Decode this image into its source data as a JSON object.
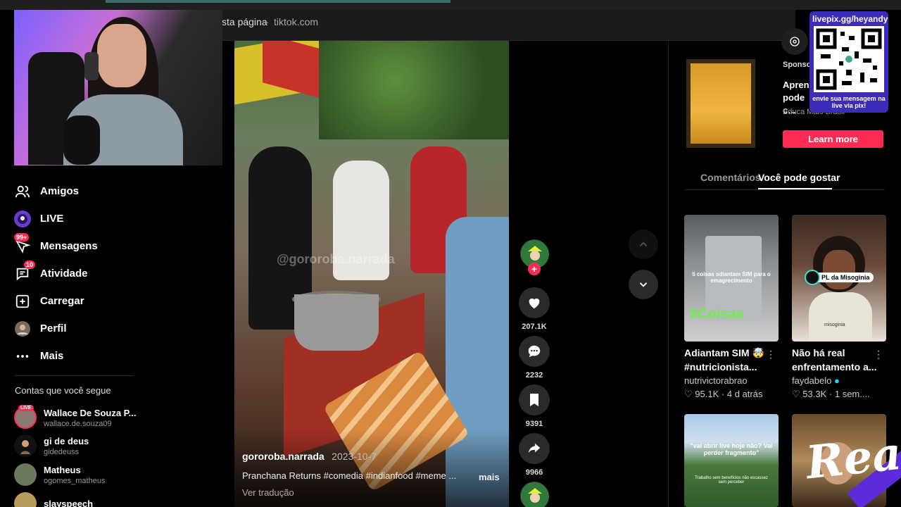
{
  "browser": {
    "tab_title": "sta página",
    "separator": "-",
    "domain": "tiktok.com"
  },
  "sidebar": {
    "items": [
      {
        "label": "Amigos",
        "icon": "friends-icon"
      },
      {
        "label": "LIVE",
        "icon": "live-icon"
      },
      {
        "label": "Mensagens",
        "icon": "messages-icon",
        "badge": "99+"
      },
      {
        "label": "Atividade",
        "icon": "activity-icon",
        "badge": "10"
      },
      {
        "label": "Carregar",
        "icon": "upload-icon"
      },
      {
        "label": "Perfil",
        "icon": "profile-avatar"
      },
      {
        "label": "Mais",
        "icon": "more-icon"
      }
    ],
    "following_title": "Contas que você segue",
    "following": [
      {
        "name": "Wallace De Souza P...",
        "handle": "wallace.de.souza09",
        "live": "LIVE"
      },
      {
        "name": "gi de deus",
        "handle": "gidedeuss"
      },
      {
        "name": "Matheus",
        "handle": "ogomes_matheus"
      },
      {
        "name": "slayspeech",
        "handle": ""
      }
    ]
  },
  "video": {
    "author": "gororoba.narrada",
    "date": "2023-10-7",
    "caption": "Pranchana Returns #comedia #indianfood #meme ...",
    "more": "mais",
    "translate": "Ver tradução",
    "watermark": "@gororoba.narrada"
  },
  "actions": {
    "likes": "207.1K",
    "comments": "2232",
    "saves": "9391",
    "shares": "9966"
  },
  "ad": {
    "sponsored": "Sponsored",
    "title": "Aprender pode c...",
    "brand": "Educa Mais Brasil",
    "button": "Learn more"
  },
  "overlay": {
    "qr_title": "livepix.gg/heyandy",
    "qr_sub": "envie sua mensagem na live via pix!",
    "react_logo": "React"
  },
  "tabs": {
    "comments": "Comentários",
    "suggestions": "Você pode gostar"
  },
  "cards": [
    {
      "thumb_text": "5 coisas adiantam SIM para o emagrecimento",
      "thumb_big": "5Coisas",
      "title": "Adiantam SIM 🤯 #nutricionista...",
      "author": "nutrivictorabrao",
      "likes": "95.1K",
      "age": "4 d atrás"
    },
    {
      "thumb_tag": "PL da Misoginia",
      "thumb_caption": "misoginia",
      "title": "Não há real enfrentamento a...",
      "author": "faydabelo",
      "likes": "53.3K",
      "age": "1 sem...."
    },
    {
      "thumb_text": "\"vai abrir live hoje não? Vai perder fragmento\"",
      "thumb_sub": "Trabalho sem benefícios não escassez sem perceber"
    },
    {}
  ],
  "colors": {
    "accent": "#fe2c55",
    "background": "#000000",
    "overlay_purple": "#3a2bb8"
  }
}
